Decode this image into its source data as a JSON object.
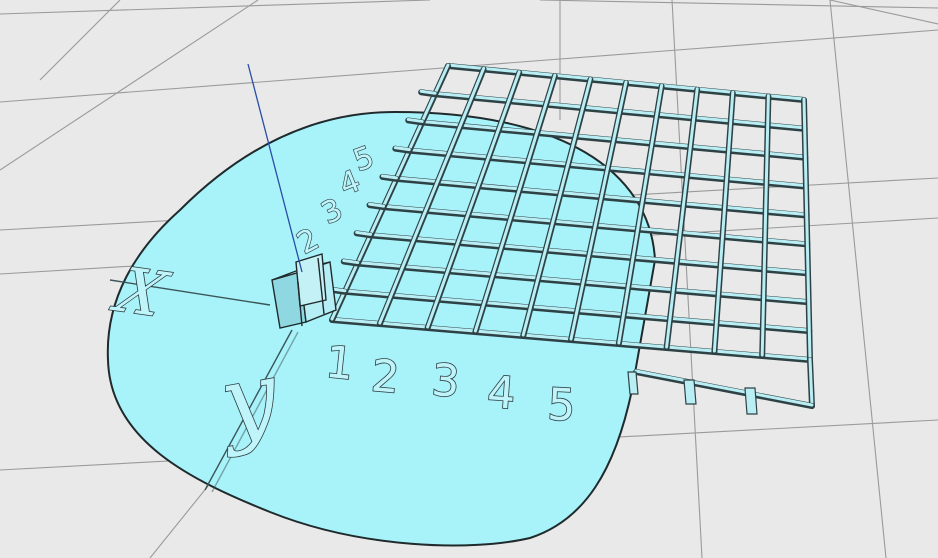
{
  "scene": {
    "background_color": "#e9e9e9",
    "floor_grid_color": "#9a9a9a",
    "base_color": "#a8f2fa",
    "base_outline_color": "#1f2a2c",
    "grid_bar_color": "#b8eef4",
    "grid_bar_edge_color": "#2e4245",
    "axis_needle_color": "#2a4da8"
  },
  "grid": {
    "columns": 10,
    "rows": 9
  },
  "labels": {
    "x_axis_letter": "X",
    "y_axis_letter": "y",
    "bottom_numbers": [
      "1",
      "2",
      "3",
      "4",
      "5"
    ],
    "side_numbers": [
      "2",
      "3",
      "4",
      "5"
    ]
  },
  "objects": {
    "block_icon": "cube-block",
    "needle_icon": "z-axis-needle"
  }
}
